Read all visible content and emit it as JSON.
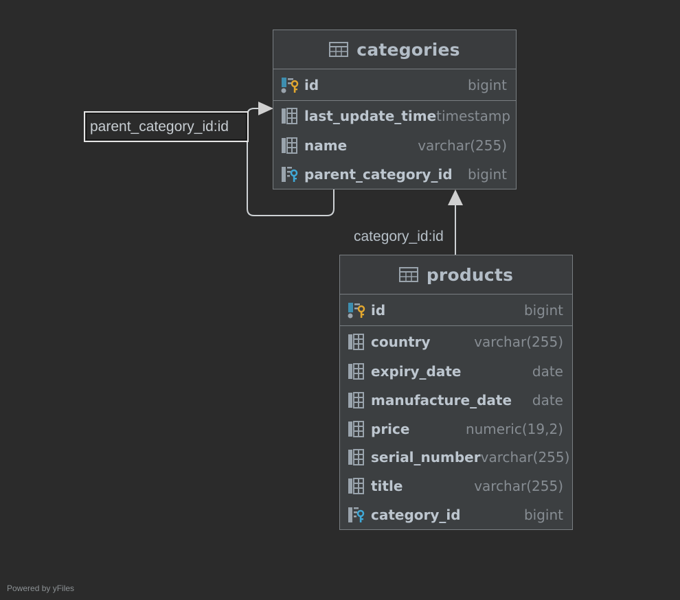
{
  "diagram": {
    "footer": "Powered by yFiles",
    "colors": {
      "background": "#2b2b2b",
      "table_fill": "#3c3f41",
      "border": "#7a7f83",
      "pk_key": "#e2a72f",
      "fk_key": "#3fa9d8"
    },
    "tables": [
      {
        "name": "categories",
        "icon": "table-icon",
        "columns": [
          {
            "name": "id",
            "type": "bigint",
            "icon": "primary-key-icon"
          },
          {
            "name": "last_update_time",
            "type": "timestamp",
            "icon": "column-icon"
          },
          {
            "name": "name",
            "type": "varchar(255)",
            "icon": "column-icon"
          },
          {
            "name": "parent_category_id",
            "type": "bigint",
            "icon": "foreign-key-icon"
          }
        ]
      },
      {
        "name": "products",
        "icon": "table-icon",
        "columns": [
          {
            "name": "id",
            "type": "bigint",
            "icon": "primary-key-icon"
          },
          {
            "name": "country",
            "type": "varchar(255)",
            "icon": "column-icon"
          },
          {
            "name": "expiry_date",
            "type": "date",
            "icon": "column-icon"
          },
          {
            "name": "manufacture_date",
            "type": "date",
            "icon": "column-icon"
          },
          {
            "name": "price",
            "type": "numeric(19,2)",
            "icon": "column-icon"
          },
          {
            "name": "serial_number",
            "type": "varchar(255)",
            "icon": "column-icon"
          },
          {
            "name": "title",
            "type": "varchar(255)",
            "icon": "column-icon"
          },
          {
            "name": "category_id",
            "type": "bigint",
            "icon": "foreign-key-icon"
          }
        ]
      }
    ],
    "relations": [
      {
        "label": "parent_category_id:id",
        "from": "categories",
        "to": "categories"
      },
      {
        "label": "category_id:id",
        "from": "products",
        "to": "categories"
      }
    ]
  }
}
